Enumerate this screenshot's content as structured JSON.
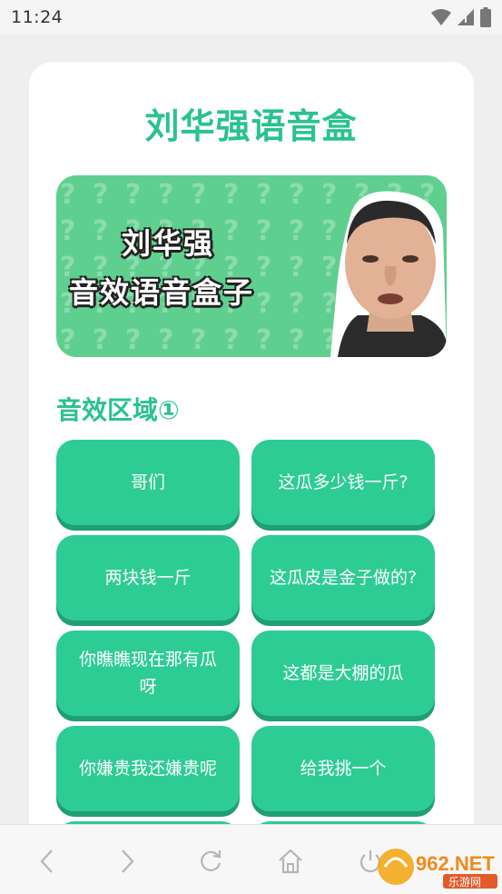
{
  "status_bar": {
    "time": "11:24"
  },
  "app": {
    "title": "刘华强语音盒"
  },
  "banner": {
    "line1": "刘华强",
    "line2": "音效语音盒子",
    "pattern_char": "?"
  },
  "section": {
    "title": "音效区域①"
  },
  "sound_buttons": [
    {
      "label": "哥们"
    },
    {
      "label": "这瓜多少钱一斤?"
    },
    {
      "label": "两块钱一斤"
    },
    {
      "label": "这瓜皮是金子做的?"
    },
    {
      "label": "你瞧瞧现在那有瓜呀"
    },
    {
      "label": "这都是大棚的瓜"
    },
    {
      "label": "你嫌贵我还嫌贵呢"
    },
    {
      "label": "给我挑一个"
    }
  ],
  "watermark": {
    "brand": "962.NET",
    "sub": "乐游网"
  },
  "colors": {
    "accent": "#2ac28f",
    "button": "#2dcc94",
    "button_shadow": "#1f9f73",
    "banner": "#5fcf8f"
  }
}
